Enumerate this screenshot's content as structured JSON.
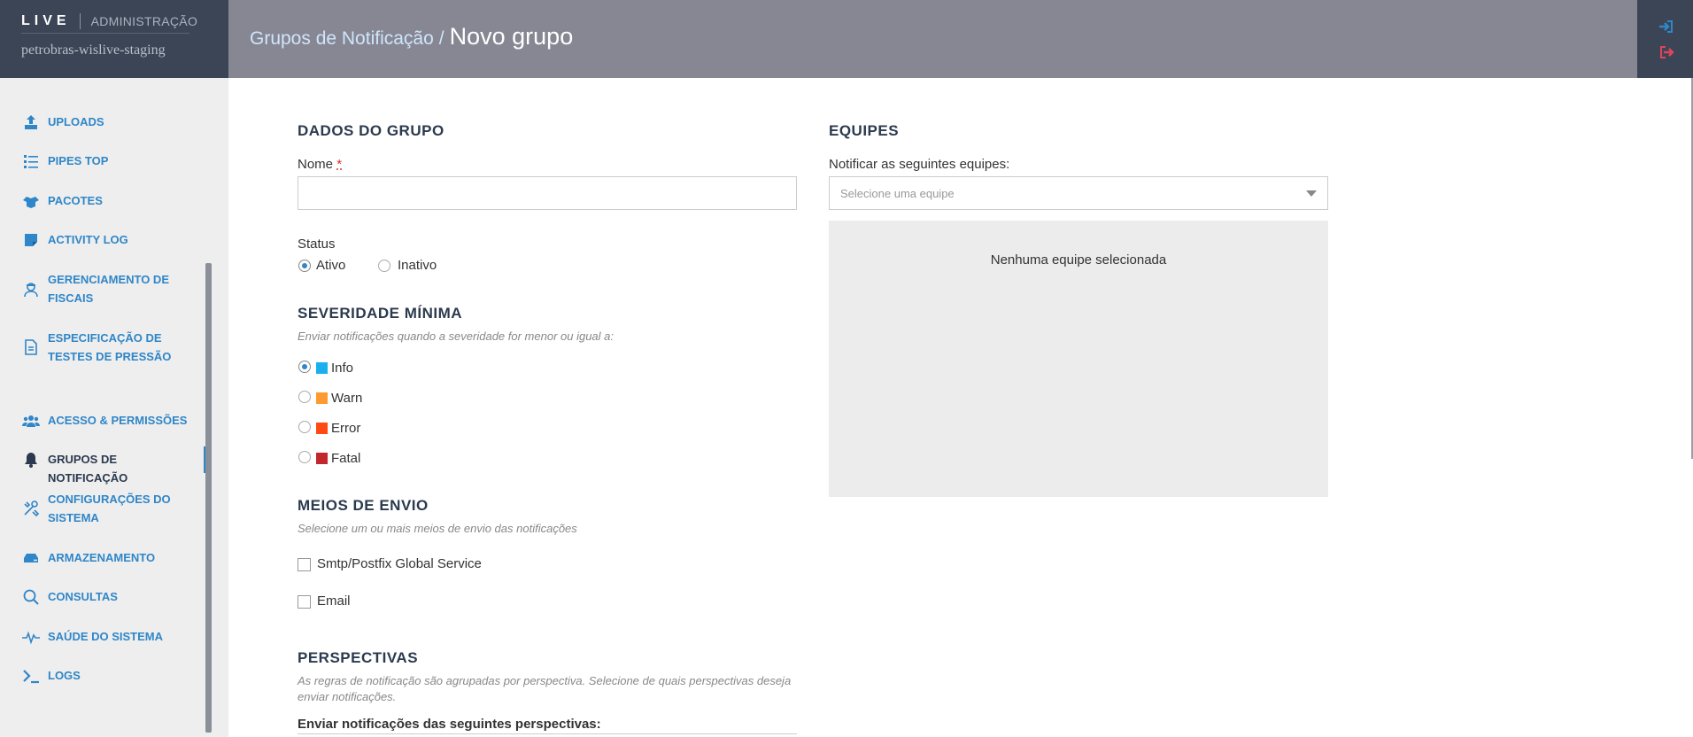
{
  "brand": {
    "logo": "LIVE",
    "section": "ADMINISTRAÇÃO",
    "environment": "petrobras-wislive-staging"
  },
  "breadcrumb": {
    "parent": "Grupos de Notificação",
    "separator": "/",
    "current": "Novo grupo"
  },
  "sidebar": {
    "items": [
      {
        "label": "UPLOADS",
        "icon": "upload-icon"
      },
      {
        "label": "PIPES TOP",
        "icon": "list-icon"
      },
      {
        "label": "PACOTES",
        "icon": "packages-icon"
      },
      {
        "label": "ACTIVITY LOG",
        "icon": "note-icon"
      },
      {
        "label": "GERENCIAMENTO DE FISCAIS",
        "icon": "inspector-icon"
      },
      {
        "label": "ESPECIFICAÇÃO DE TESTES DE PRESSÃO",
        "icon": "document-icon"
      },
      {
        "label": "ACESSO & PERMISSÕES",
        "icon": "users-icon"
      },
      {
        "label": "GRUPOS DE NOTIFICAÇÃO",
        "icon": "bell-icon",
        "active": true
      },
      {
        "label": "CONFIGURAÇÕES DO SISTEMA",
        "icon": "tools-icon"
      },
      {
        "label": "ARMAZENAMENTO",
        "icon": "storage-icon"
      },
      {
        "label": "CONSULTAS",
        "icon": "search-icon"
      },
      {
        "label": "SAÚDE DO SISTEMA",
        "icon": "pulse-icon"
      },
      {
        "label": "LOGS",
        "icon": "terminal-icon"
      }
    ]
  },
  "header_icons": [
    "sign-in-icon",
    "sign-out-icon"
  ],
  "group_data": {
    "title": "DADOS DO GRUPO",
    "name_label": "Nome",
    "required_mark": "*",
    "name_value": "",
    "status_label": "Status",
    "status_options": [
      "Ativo",
      "Inativo"
    ],
    "status_selected": "Ativo"
  },
  "severity": {
    "title": "SEVERIDADE MÍNIMA",
    "hint": "Enviar notificações quando a severidade for menor ou igual a:",
    "options": [
      {
        "label": "Info",
        "color": "#1ab0f0",
        "selected": true
      },
      {
        "label": "Warn",
        "color": "#ff9a30",
        "selected": false
      },
      {
        "label": "Error",
        "color": "#ff4a14",
        "selected": false
      },
      {
        "label": "Fatal",
        "color": "#c1272d",
        "selected": false
      }
    ]
  },
  "delivery": {
    "title": "MEIOS DE ENVIO",
    "hint": "Selecione um ou mais meios de envio das notificações",
    "options": [
      {
        "label": "Smtp/Postfix Global Service",
        "checked": false
      },
      {
        "label": "Email",
        "checked": false
      }
    ]
  },
  "perspectives": {
    "title": "PERSPECTIVAS",
    "hint": "As regras de notificação são agrupadas por perspectiva. Selecione de quais perspectivas deseja enviar notificações.",
    "field_label": "Enviar notificações das seguintes perspectivas:"
  },
  "teams": {
    "title": "EQUIPES",
    "field_label": "Notificar as seguintes equipes:",
    "placeholder": "Selecione uma equipe",
    "empty_text": "Nenhuma equipe selecionada"
  },
  "colors": {
    "accent": "#2f86c8",
    "sidebar_dark": "#3b4556",
    "header": "#878794"
  }
}
